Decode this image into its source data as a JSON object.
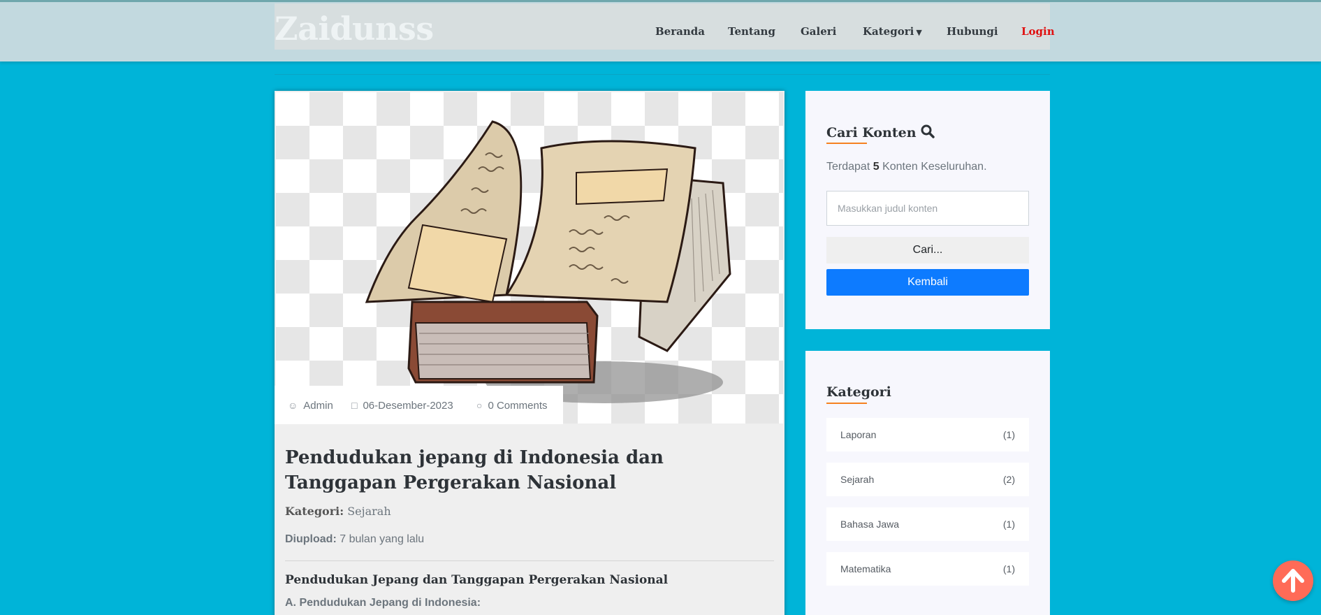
{
  "brand": "Zaidunss",
  "nav": {
    "items": [
      "Beranda",
      "Tentang",
      "Galeri",
      "Kategori",
      "Hubungi"
    ],
    "login": "Login"
  },
  "article": {
    "meta": {
      "author": "Admin",
      "date": "06-Desember-2023",
      "comments": "0 Comments"
    },
    "title": "Pendudukan jepang di Indonesia dan Tanggapan Pergerakan Nasional",
    "category_label": "Kategori:",
    "category_value": "Sejarah",
    "uploaded_label": "Diupload:",
    "uploaded_value": "7 bulan yang lalu",
    "section_heading": "Pendudukan Jepang dan Tanggapan Pergerakan Nasional",
    "section_subheading": "A. Pendudukan Jepang di Indonesia:"
  },
  "search": {
    "title": "Cari Konten",
    "count_prefix": "Terdapat",
    "count_value": "5",
    "count_suffix": "Konten Keseluruhan.",
    "placeholder": "Masukkan judul konten",
    "submit_label": "Cari...",
    "back_label": "Kembali"
  },
  "categories": {
    "title": "Kategori",
    "items": [
      {
        "name": "Laporan",
        "count": "(1)"
      },
      {
        "name": "Sejarah",
        "count": "(2)"
      },
      {
        "name": "Bahasa Jawa",
        "count": "(1)"
      },
      {
        "name": "Matematika",
        "count": "(1)"
      }
    ]
  },
  "colors": {
    "page_bg": "#00b4d8",
    "accent_underline": "#f58220",
    "primary_button": "#0d7bff",
    "login_link": "#e01010",
    "scroll_top_button": "#ff6b57"
  },
  "icons": [
    "user-icon",
    "calendar-icon",
    "comment-icon",
    "search-icon",
    "arrow-up-icon",
    "caret-down-icon"
  ]
}
